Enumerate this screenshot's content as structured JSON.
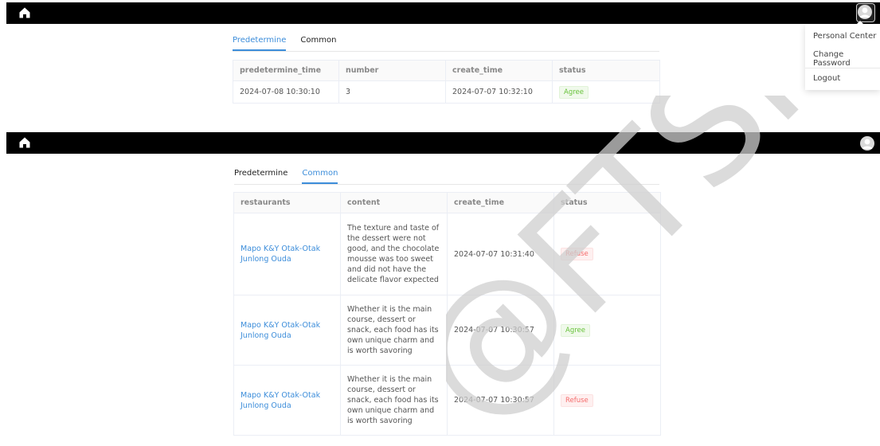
{
  "panel1": {
    "tabs": [
      {
        "label": "Predetermine",
        "active": true
      },
      {
        "label": "Common",
        "active": false
      }
    ],
    "table": {
      "headers": [
        "predetermine_time",
        "number",
        "create_time",
        "status"
      ],
      "rows": [
        {
          "predetermine_time": "2024-07-08 10:30:10",
          "number": "3",
          "create_time": "2024-07-07 10:32:10",
          "status": "Agree"
        }
      ]
    }
  },
  "user_menu": {
    "items": [
      "Personal Center",
      "Change Password",
      "Logout"
    ]
  },
  "panel2": {
    "tabs": [
      {
        "label": "Predetermine",
        "active": false
      },
      {
        "label": "Common",
        "active": true
      }
    ],
    "table": {
      "headers": [
        "restaurants",
        "content",
        "create_time",
        "status"
      ],
      "rows": [
        {
          "restaurant": "Mapo K&Y Otak-Otak Junlong Ouda",
          "content": "The texture and taste of the dessert were not good, and the chocolate mousse was too sweet and did not have the delicate flavor expected",
          "create_time": "2024-07-07 10:31:40",
          "status": "Refuse"
        },
        {
          "restaurant": "Mapo K&Y Otak-Otak Junlong Ouda",
          "content": "Whether it is the main course, dessert or snack, each food has its own unique charm and is worth savoring",
          "create_time": "2024-07-07 10:30:57",
          "status": "Agree"
        },
        {
          "restaurant": "Mapo K&Y Otak-Otak Junlong Ouda",
          "content": "Whether it is the main course, dessert or snack, each food has its own unique charm and is worth savoring",
          "create_time": "2024-07-07 10:30:57",
          "status": "Refuse"
        }
      ]
    }
  },
  "watermark": {
    "text": "@FTSM"
  },
  "colors": {
    "accent": "#3c8dda",
    "agree": "#67c23a",
    "refuse": "#f56c6c",
    "topbar": "#000000"
  }
}
